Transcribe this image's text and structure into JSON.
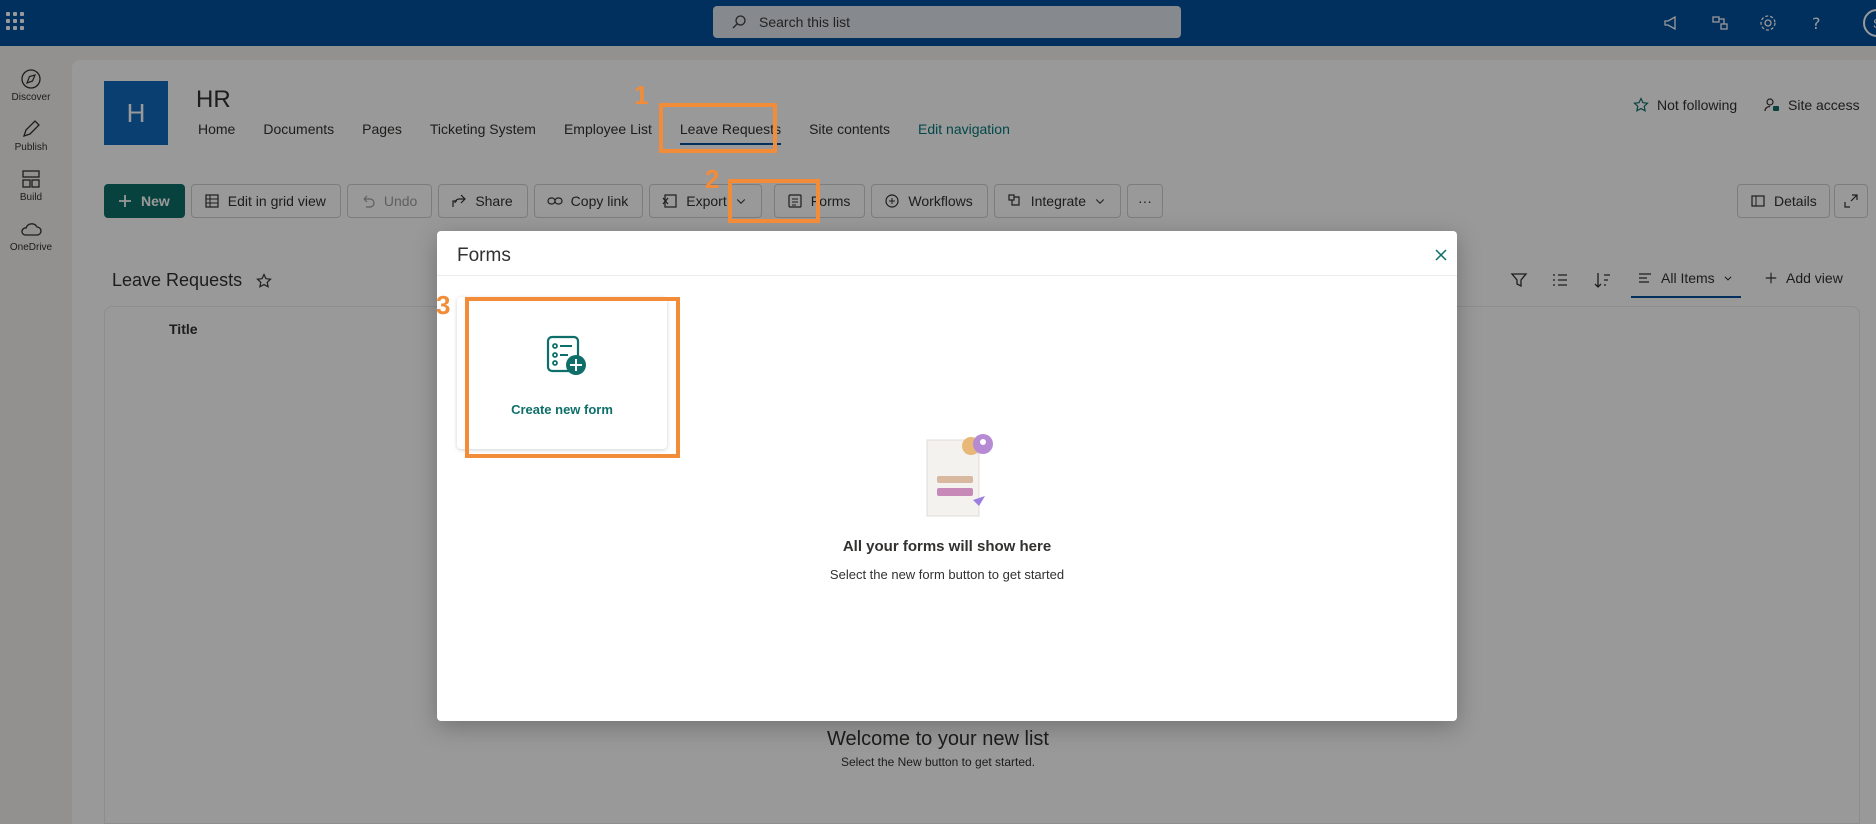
{
  "search": {
    "placeholder": "Search this list"
  },
  "suite": {
    "avatar_initial": "S"
  },
  "rail": [
    {
      "label": "Discover"
    },
    {
      "label": "Publish"
    },
    {
      "label": "Build"
    },
    {
      "label": "OneDrive"
    }
  ],
  "site": {
    "logo_letter": "H",
    "title": "HR",
    "nav": [
      "Home",
      "Documents",
      "Pages",
      "Ticketing System",
      "Employee List",
      "Leave Requests",
      "Site contents",
      "Edit navigation"
    ],
    "follow": "Not following",
    "access": "Site access"
  },
  "commands": {
    "new": "New",
    "grid": "Edit in grid view",
    "undo": "Undo",
    "share": "Share",
    "copylink": "Copy link",
    "export": "Export",
    "forms": "Forms",
    "workflows": "Workflows",
    "integrate": "Integrate",
    "more": "···",
    "details": "Details"
  },
  "list": {
    "title": "Leave Requests",
    "view": "All Items",
    "addview": "Add view",
    "column_title": "Title",
    "welcome": "Welcome to your new list",
    "welcome_sub": "Select the New button to get started."
  },
  "dialog": {
    "title": "Forms",
    "create_label": "Create new form",
    "empty_title": "All your forms will show here",
    "empty_sub": "Select the new form button to get started"
  },
  "annotations": {
    "n1": "1",
    "n2": "2",
    "n3": "3"
  },
  "colors": {
    "suitebar": "#03519e",
    "accent": "#0e6f6a",
    "annotation": "#f28c38"
  }
}
